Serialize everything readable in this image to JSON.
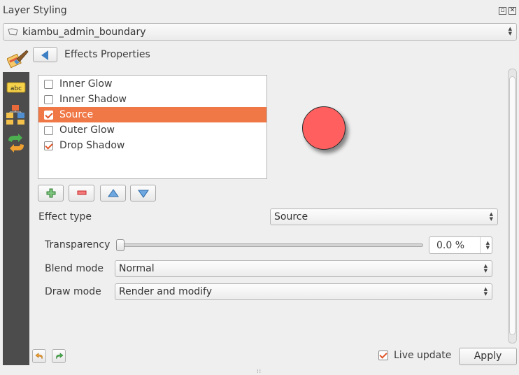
{
  "window": {
    "title": "Layer Styling",
    "float_icon": "restore-icon",
    "close_icon": "close-icon"
  },
  "layer_combo": {
    "icon": "polygon-layer-icon",
    "value": "kiambu_admin_boundary"
  },
  "panel": {
    "back_icon": "back-arrow-icon",
    "heading": "Effects Properties"
  },
  "sidebar": {
    "items": [
      "label-abc-icon",
      "layers-tree-icon",
      "history-icon"
    ]
  },
  "effects": [
    {
      "label": "Inner Glow",
      "checked": false,
      "selected": false
    },
    {
      "label": "Inner Shadow",
      "checked": false,
      "selected": false
    },
    {
      "label": "Source",
      "checked": true,
      "selected": true
    },
    {
      "label": "Outer Glow",
      "checked": false,
      "selected": false
    },
    {
      "label": "Drop Shadow",
      "checked": true,
      "selected": false
    }
  ],
  "list_buttons": {
    "add": "add-icon",
    "remove": "remove-icon",
    "up": "move-up-icon",
    "down": "move-down-icon"
  },
  "preview": {
    "fill": "#ff5f5f",
    "stroke": "#2a2a2a"
  },
  "effect_type": {
    "label": "Effect type",
    "value": "Source"
  },
  "transparency": {
    "label": "Transparency",
    "value": "0.0 %",
    "level": 0
  },
  "blend_mode": {
    "label": "Blend mode",
    "value": "Normal"
  },
  "draw_mode": {
    "label": "Draw mode",
    "value": "Render and modify"
  },
  "footer": {
    "undo_icon": "undo-icon",
    "redo_icon": "redo-icon",
    "live_update_label": "Live update",
    "live_update_checked": true,
    "apply_label": "Apply"
  },
  "colors": {
    "accent": "#f07746",
    "check": "#e0572a",
    "back_arrow": "#3d7fc4",
    "sidebar": "#4c4c4c"
  }
}
